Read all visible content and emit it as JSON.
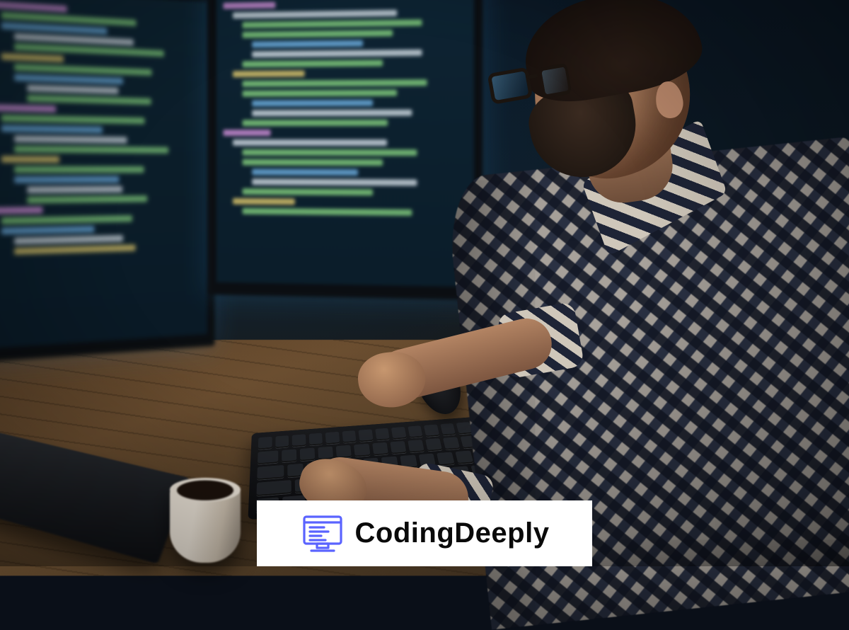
{
  "badge": {
    "brand_text": "CodingDeeply",
    "icon_name": "computer-code-icon",
    "icon_color": "#5a63ff"
  },
  "scene": {
    "description": "Bearded man with glasses and checkered shirt coding at a wooden desk with dual monitors, keyboard, mouse, laptop, and a coffee mug in a dim room.",
    "code_palette": {
      "green": "#7ec77a",
      "blue": "#6aa8d8",
      "purple": "#c88bd1",
      "white": "#c9d3dc",
      "yellow": "#d3c06a"
    }
  }
}
